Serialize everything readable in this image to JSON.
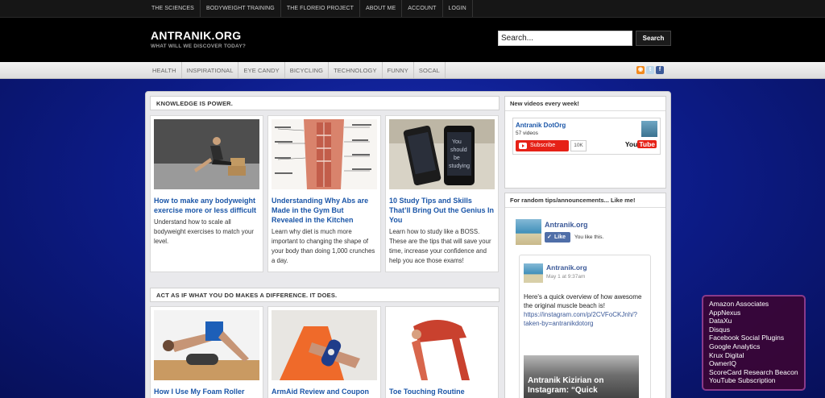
{
  "topnav": {
    "items": [
      "THE SCIENCES",
      "BODYWEIGHT TRAINING",
      "THE FLOREIO PROJECT",
      "ABOUT ME",
      "ACCOUNT",
      "LOGIN"
    ]
  },
  "header": {
    "title": "ANTRANIK.ORG",
    "tagline": "WHAT WILL WE DISCOVER TODAY?"
  },
  "search": {
    "placeholder": "Search...",
    "button": "Search"
  },
  "catnav": {
    "items": [
      "HEALTH",
      "INSPIRATIONAL",
      "EYE CANDY",
      "BICYCLING",
      "TECHNOLOGY",
      "FUNNY",
      "SOCAL"
    ]
  },
  "social": {
    "icons": [
      "rss-icon",
      "twitter-icon",
      "facebook-icon"
    ]
  },
  "sections": [
    {
      "title": "KNOWLEDGE IS POWER.",
      "cards": [
        {
          "title": "How to make any bodyweight exercise more or less difficult",
          "excerpt": "Understand how to scale all bodyweight exercises to match your level."
        },
        {
          "title": "Understanding Why Abs are Made in the Gym But Revealed in the Kitchen",
          "excerpt": "Learn why diet is much more important to changing the shape of your body than doing 1,000 crunches a day."
        },
        {
          "title": "10 Study Tips and Skills That’ll Bring Out the Genius In You",
          "excerpt": "Learn how to study like a BOSS. These are the tips that will save your time, increase your confidence and help you ace those exams!"
        }
      ]
    },
    {
      "title": "ACT AS IF WHAT YOU DO MAKES A DIFFERENCE. IT DOES.",
      "cards": [
        {
          "title": "How I Use My Foam Roller"
        },
        {
          "title": "ArmAid Review and Coupon"
        },
        {
          "title": "Toe Touching Routine"
        }
      ]
    }
  ],
  "sidebar": {
    "youtube": {
      "widget_title": "New videos every week!",
      "channel": "Antranik DotOrg",
      "videos": "57 videos",
      "subscribe": "Subscribe",
      "subs": "10K",
      "logo_you": "You",
      "logo_tube": "Tube"
    },
    "facebook": {
      "widget_title": "For random tips/announcements... Like me!",
      "page_name": "Antranik.org",
      "like": "Like",
      "you_like": "You like this.",
      "post": {
        "author": "Antranik.org",
        "time": "May 1 at 9:37am",
        "text": "Here's a quick overview of how awesome the original muscle beach is!",
        "link": "https://instagram.com/p/2CVFoCKJnh/?taken-by=antranikdotorg",
        "media_caption": "Antranik Kizirian on Instagram: “Quick"
      }
    }
  },
  "trackers": [
    "Amazon Associates",
    "AppNexus",
    "DataXu",
    "Disqus",
    "Facebook Social Plugins",
    "Google Analytics",
    "Krux Digital",
    "OwnerIQ",
    "ScoreCard Research Beacon",
    "YouTube Subscription"
  ]
}
